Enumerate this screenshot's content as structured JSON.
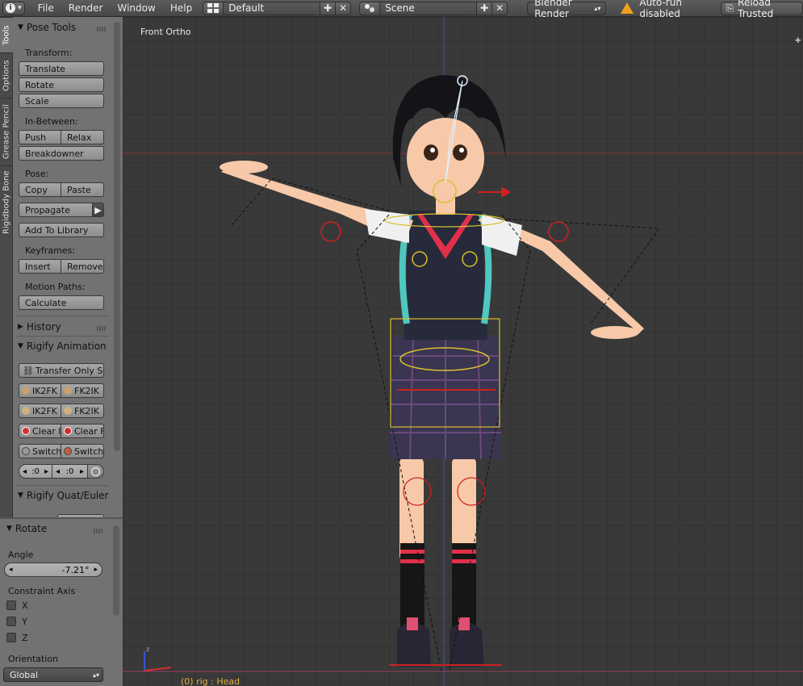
{
  "topbar": {
    "menus": [
      "File",
      "Render",
      "Window",
      "Help"
    ],
    "layout": "Default",
    "scene": "Scene",
    "engine": "Blender Render",
    "warning": "Auto-run disabled",
    "reload": "Reload Trusted"
  },
  "tabs": [
    "Tools",
    "Options",
    "Grease Pencil",
    "Rigidbody Bone"
  ],
  "toolshelf": {
    "pose_tools": "Pose Tools",
    "transform_label": "Transform:",
    "translate": "Translate",
    "rotate": "Rotate",
    "scale": "Scale",
    "inbetween_label": "In-Between:",
    "push": "Push",
    "relax": "Relax",
    "breakdowner": "Breakdowner",
    "pose_label": "Pose:",
    "copy": "Copy",
    "paste": "Paste",
    "propagate": "Propagate",
    "add_to_library": "Add To Library",
    "keyframes_label": "Keyframes:",
    "insert": "Insert",
    "remove": "Remove",
    "motion_paths_label": "Motion Paths:",
    "calculate": "Calculate",
    "history": "History",
    "rigify_animation": "Rigify Animation",
    "transfer_only": "Transfer Only S...",
    "ik2fk_1": "IK2FK",
    "fk2ik_1": "FK2IK",
    "ik2fk_2": "IK2FK",
    "fk2ik_2": "FK2IK",
    "clear_1": "Clear I",
    "clear_2": "Clear F",
    "switch_1": "Switch",
    "switch_2": "Switch",
    "frame_start": "0",
    "frame_end": "0",
    "rigify_quat": "Rigify Quat/Euler"
  },
  "operator": {
    "title": "Rotate",
    "angle_label": "Angle",
    "angle_value": "-7.21°",
    "constraint_label": "Constraint Axis",
    "axes": [
      "X",
      "Y",
      "Z"
    ],
    "orientation_label": "Orientation",
    "orientation_value": "Global"
  },
  "viewport": {
    "view_label": "Front Ortho",
    "status": "(0) rig : Head",
    "colors": {
      "skin": "#f7c9a8",
      "shirt": "#262a3a",
      "skirt": "#3a3550",
      "hair": "#141418",
      "accent_red": "#e0304a",
      "teal": "#4fc7c0",
      "rig_red": "#d02020",
      "rig_yellow": "#d8c030"
    }
  }
}
